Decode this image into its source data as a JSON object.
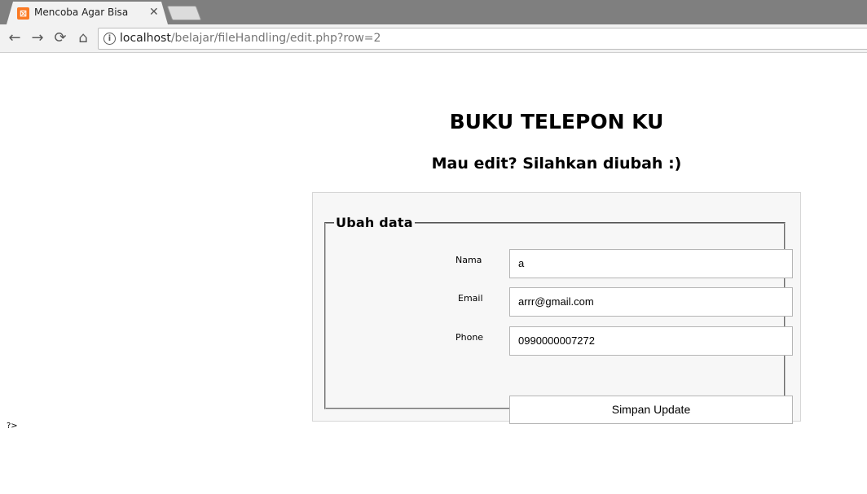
{
  "browser": {
    "tab_title": "Mencoba Agar Bisa",
    "tab_close": "✕",
    "favicon_glyph": "⊠",
    "url_host": "localhost",
    "url_path": "/belajar/fileHandling/edit.php?row=2",
    "nav": {
      "back": "←",
      "forward": "→",
      "reload": "⟳",
      "home": "⌂",
      "info": "i"
    }
  },
  "page": {
    "title": "BUKU TELEPON KU",
    "subtitle": "Mau edit? Silahkan diubah :)",
    "form": {
      "legend": "Ubah data",
      "fields": [
        {
          "label": "Nama",
          "value": "a"
        },
        {
          "label": "Email",
          "value": "arrr@gmail.com"
        },
        {
          "label": "Phone",
          "value": "0990000007272"
        }
      ],
      "submit_label": "Simpan Update"
    },
    "stray_text": "?>"
  }
}
